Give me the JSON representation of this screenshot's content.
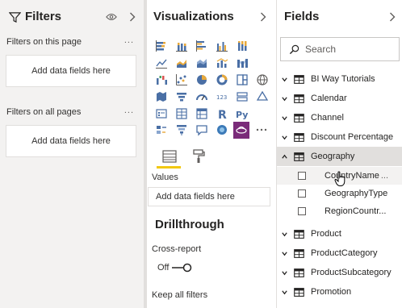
{
  "filters": {
    "title": "Filters",
    "on_page_label": "Filters on this page",
    "on_page_more": "...",
    "on_page_drop": "Add data fields here",
    "all_pages_label": "Filters on all pages",
    "all_pages_more": "...",
    "all_pages_drop": "Add data fields here"
  },
  "visualizations": {
    "title": "Visualizations",
    "icon_rows": [
      [
        "stacked-bar-icon",
        "stacked-column-icon",
        "clustered-bar-icon",
        "clustered-column-icon",
        "100-stacked-bar-icon"
      ],
      [
        "line-chart-icon",
        "area-chart-icon",
        "stacked-area-icon",
        "line-column-icon",
        "ribbon-chart-icon"
      ],
      [
        "waterfall-icon",
        "scatter-icon",
        "pie-chart-icon",
        "donut-chart-icon",
        "treemap-icon",
        "map-icon"
      ],
      [
        "filled-map-icon",
        "funnel-icon",
        "gauge-icon",
        "card-icon",
        "multi-row-card-icon",
        "kpi-icon"
      ],
      [
        "slicer-icon",
        "table-icon",
        "matrix-icon",
        "r-visual-icon",
        "python-visual-icon"
      ],
      [
        "key-influencers-icon",
        "decomposition-tree-icon",
        "qa-icon",
        "arcgis-icon",
        "custom-visual-icon",
        "more-icon"
      ]
    ],
    "values_label": "Values",
    "values_drop": "Add data fields here",
    "drill_title": "Drillthrough",
    "cross_report_label": "Cross-report",
    "cross_report_state": "Off",
    "keep_filters_label": "Keep all filters",
    "accent_color": "#f2c811"
  },
  "fields": {
    "title": "Fields",
    "search_placeholder": "Search",
    "tables": [
      {
        "name": "BI Way Tutorials"
      },
      {
        "name": "Calendar"
      },
      {
        "name": "Channel"
      },
      {
        "name": "Discount Percentage"
      },
      {
        "name": "Geography",
        "expanded": true
      },
      {
        "name": "Product"
      },
      {
        "name": "ProductCategory"
      },
      {
        "name": "ProductSubcategory"
      },
      {
        "name": "Promotion"
      }
    ],
    "geography_fields": [
      {
        "name": "CountryName",
        "more": "..."
      },
      {
        "name": "GeographyType"
      },
      {
        "name": "RegionCountr..."
      }
    ]
  }
}
